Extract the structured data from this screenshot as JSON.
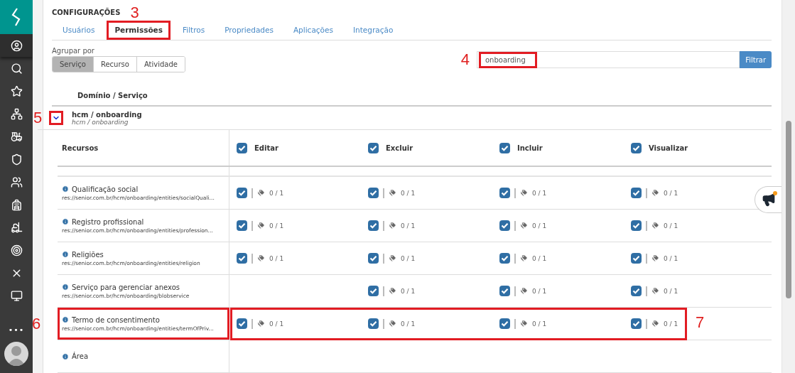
{
  "sidebar": {
    "items": [
      {
        "kind": "user",
        "selected": true
      },
      {
        "kind": "search",
        "selected": false
      },
      {
        "kind": "star",
        "selected": false
      },
      {
        "kind": "hierarchy",
        "selected": false
      },
      {
        "kind": "tractor",
        "selected": false
      },
      {
        "kind": "shield",
        "selected": false
      },
      {
        "kind": "team",
        "selected": false
      },
      {
        "kind": "backpack",
        "selected": false
      },
      {
        "kind": "forklift",
        "selected": false
      },
      {
        "kind": "target",
        "selected": false
      },
      {
        "kind": "x",
        "selected": false
      },
      {
        "kind": "monitor",
        "selected": false
      }
    ],
    "more": "•••"
  },
  "title": "CONFIGURAÇÕES",
  "title_marker": "3",
  "tabs": [
    {
      "label": "Usuários",
      "selected": false,
      "highlighted": false
    },
    {
      "label": "Permissões",
      "selected": true,
      "highlighted": true
    },
    {
      "label": "Filtros",
      "selected": false,
      "highlighted": false
    },
    {
      "label": "Propriedades",
      "selected": false,
      "highlighted": false
    },
    {
      "label": "Aplicações",
      "selected": false,
      "highlighted": false
    },
    {
      "label": "Integração",
      "selected": false,
      "highlighted": false
    }
  ],
  "group_by": {
    "label": "Agrupar por",
    "options": [
      {
        "label": "Serviço",
        "selected": true
      },
      {
        "label": "Recurso",
        "selected": false
      },
      {
        "label": "Atividade",
        "selected": false
      }
    ]
  },
  "search": {
    "value": "onboarding",
    "button": "Filtrar",
    "marker": "4",
    "highlighted": true
  },
  "list_header": "Domínio / Serviço",
  "group": {
    "name": "hcm / onboarding",
    "subtitle": "hcm / onboarding",
    "expanded": true,
    "marker": "5",
    "highlighted": true
  },
  "resources": {
    "header": "Recursos",
    "columns": [
      {
        "label": "Editar",
        "checked": true
      },
      {
        "label": "Excluir",
        "checked": true
      },
      {
        "label": "Incluir",
        "checked": true
      },
      {
        "label": "Visualizar",
        "checked": true
      }
    ],
    "rows": [
      {
        "name": "Qualificação social",
        "uri": "res://senior.com.br/hcm/onboarding/entities/socialQuali...",
        "highlighted": false,
        "cells": [
          {
            "kind": "checkbox",
            "checked": true,
            "count": "0 / 1"
          },
          {
            "kind": "checkbox",
            "checked": true,
            "count": "0 / 1"
          },
          {
            "kind": "checkbox",
            "checked": true,
            "count": "0 / 1"
          },
          {
            "kind": "checkbox",
            "checked": true,
            "count": "0 / 1"
          }
        ]
      },
      {
        "name": "Registro profissional",
        "uri": "res://senior.com.br/hcm/onboarding/entities/profession...",
        "highlighted": false,
        "cells": [
          {
            "kind": "checkbox",
            "checked": true,
            "count": "0 / 1"
          },
          {
            "kind": "checkbox",
            "checked": true,
            "count": "0 / 1"
          },
          {
            "kind": "checkbox",
            "checked": true,
            "count": "0 / 1"
          },
          {
            "kind": "checkbox",
            "checked": true,
            "count": "0 / 1"
          }
        ]
      },
      {
        "name": "Religiões",
        "uri": "res://senior.com.br/hcm/onboarding/entities/religion",
        "highlighted": false,
        "cells": [
          {
            "kind": "checkbox",
            "checked": true,
            "count": "0 / 1"
          },
          {
            "kind": "checkbox",
            "checked": true,
            "count": "0 / 1"
          },
          {
            "kind": "checkbox",
            "checked": true,
            "count": "0 / 1"
          },
          {
            "kind": "checkbox",
            "checked": true,
            "count": "0 / 1"
          }
        ]
      },
      {
        "name": "Serviço para gerenciar anexos",
        "uri": "res://senior.com.br/hcm/onboarding/blobservice",
        "highlighted": false,
        "cells": [
          {
            "kind": "empty"
          },
          {
            "kind": "checkbox",
            "checked": true,
            "count": "0 / 1"
          },
          {
            "kind": "checkbox",
            "checked": true,
            "count": "0 / 1"
          },
          {
            "kind": "checkbox",
            "checked": true,
            "count": "0 / 1"
          }
        ]
      },
      {
        "name": "Termo de consentimento",
        "uri": "res://senior.com.br/hcm/onboarding/entities/termOfPriv...",
        "highlighted": true,
        "marker": "6",
        "cells_marker": "7",
        "cells": [
          {
            "kind": "checkbox",
            "checked": true,
            "count": "0 / 1"
          },
          {
            "kind": "checkbox",
            "checked": true,
            "count": "0 / 1"
          },
          {
            "kind": "checkbox",
            "checked": true,
            "count": "0 / 1"
          },
          {
            "kind": "checkbox",
            "checked": true,
            "count": "0 / 1"
          }
        ]
      },
      {
        "name": "Área",
        "highlighted": false,
        "cells": []
      }
    ]
  }
}
